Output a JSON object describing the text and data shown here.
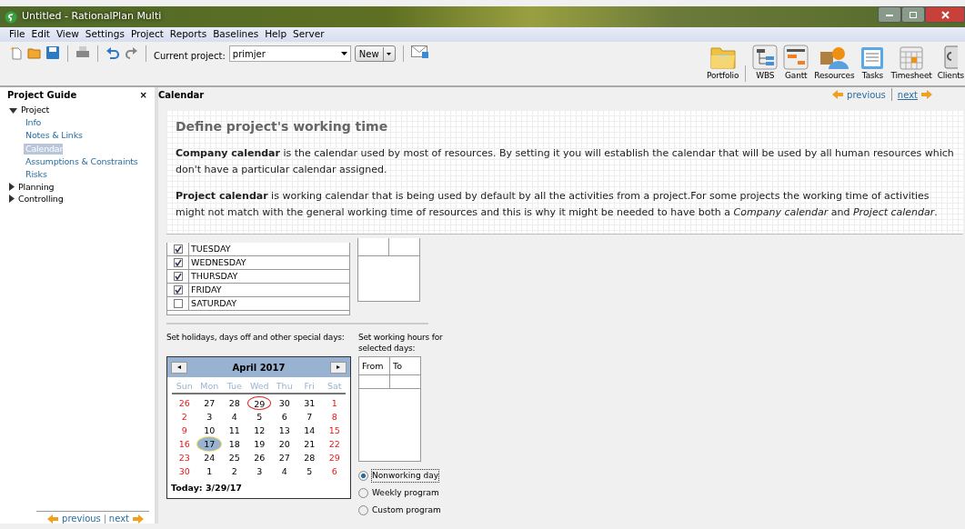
{
  "window": {
    "title": "Untitled - RationalPlan Multi"
  },
  "menu": [
    "File",
    "Edit",
    "View",
    "Settings",
    "Project",
    "Reports",
    "Baselines",
    "Help",
    "Server"
  ],
  "toolbar": {
    "current_project_label": "Current project:",
    "current_project": "primjer",
    "new_button": "New",
    "modules": [
      {
        "label": "Portfolio",
        "kind": "portfolio"
      },
      {
        "label": "WBS",
        "kind": "wbs"
      },
      {
        "label": "Gantt",
        "kind": "gantt"
      },
      {
        "label": "Resources",
        "kind": "resources"
      },
      {
        "label": "Tasks",
        "kind": "tasks"
      },
      {
        "label": "Timesheet",
        "kind": "timesheet"
      },
      {
        "label": "Clients",
        "kind": "clients"
      }
    ]
  },
  "project_guide": {
    "title": "Project Guide",
    "close": "×",
    "tree": [
      {
        "label": "Project",
        "expanded": true,
        "selected": false,
        "children": [
          {
            "label": "Info",
            "selected": false
          },
          {
            "label": "Notes & Links",
            "selected": false
          },
          {
            "label": "Calendar",
            "selected": true
          },
          {
            "label": "Assumptions & Constraints",
            "selected": false
          },
          {
            "label": "Risks",
            "selected": false
          }
        ]
      },
      {
        "label": "Planning",
        "expanded": false,
        "selected": false
      },
      {
        "label": "Controlling",
        "expanded": false,
        "selected": false
      }
    ],
    "previous": "previous",
    "next": "next"
  },
  "content": {
    "title": "Calendar",
    "previous": "previous",
    "next": "next",
    "help": {
      "heading": "Define project's working time",
      "paragraphs": [
        "**Company calendar** is the calendar used by most of resources. By setting it you will establish the calendar that will be used by all human resources which don't have a particular calendar assigned.",
        "**Project calendar** is working calendar that is being used by default by all the activities from a project.For some projects the working time of activities might not match with the general working time of resources and this is why it might be needed to have both a *Company calendar* and *Project calendar*."
      ]
    },
    "weekdays": [
      {
        "label": "TUESDAY",
        "checked": true
      },
      {
        "label": "WEDNESDAY",
        "checked": true
      },
      {
        "label": "THURSDAY",
        "checked": true
      },
      {
        "label": "FRIDAY",
        "checked": true
      },
      {
        "label": "SATURDAY",
        "checked": false
      }
    ],
    "holidays_label": "Set holidays, days off and other special days:",
    "hours_label": "Set working hours for selected days:",
    "calendar": {
      "month": "April 2017",
      "prev": "◂",
      "next": "▸",
      "day_names": [
        "Sun",
        "Mon",
        "Tue",
        "Wed",
        "Thu",
        "Fri",
        "Sat"
      ],
      "weeks": [
        [
          {
            "day": "26",
            "weekend": true,
            "today": false,
            "selected": false
          },
          {
            "day": "27",
            "weekend": false,
            "today": false,
            "selected": false
          },
          {
            "day": "28",
            "weekend": false,
            "today": false,
            "selected": false
          },
          {
            "day": "29",
            "weekend": false,
            "today": true,
            "selected": false
          },
          {
            "day": "30",
            "weekend": false,
            "today": false,
            "selected": false
          },
          {
            "day": "31",
            "weekend": false,
            "today": false,
            "selected": false
          },
          {
            "day": "1",
            "weekend": true,
            "today": false,
            "selected": false
          }
        ],
        [
          {
            "day": "2",
            "weekend": true,
            "today": false,
            "selected": false
          },
          {
            "day": "3",
            "weekend": false,
            "today": false,
            "selected": false
          },
          {
            "day": "4",
            "weekend": false,
            "today": false,
            "selected": false
          },
          {
            "day": "5",
            "weekend": false,
            "today": false,
            "selected": false
          },
          {
            "day": "6",
            "weekend": false,
            "today": false,
            "selected": false
          },
          {
            "day": "7",
            "weekend": false,
            "today": false,
            "selected": false
          },
          {
            "day": "8",
            "weekend": true,
            "today": false,
            "selected": false
          }
        ],
        [
          {
            "day": "9",
            "weekend": true,
            "today": false,
            "selected": false
          },
          {
            "day": "10",
            "weekend": false,
            "today": false,
            "selected": false
          },
          {
            "day": "11",
            "weekend": false,
            "today": false,
            "selected": false
          },
          {
            "day": "12",
            "weekend": false,
            "today": false,
            "selected": false
          },
          {
            "day": "13",
            "weekend": false,
            "today": false,
            "selected": false
          },
          {
            "day": "14",
            "weekend": false,
            "today": false,
            "selected": false
          },
          {
            "day": "15",
            "weekend": true,
            "today": false,
            "selected": false
          }
        ],
        [
          {
            "day": "16",
            "weekend": true,
            "today": false,
            "selected": false
          },
          {
            "day": "17",
            "weekend": false,
            "today": false,
            "selected": true
          },
          {
            "day": "18",
            "weekend": false,
            "today": false,
            "selected": false
          },
          {
            "day": "19",
            "weekend": false,
            "today": false,
            "selected": false
          },
          {
            "day": "20",
            "weekend": false,
            "today": false,
            "selected": false
          },
          {
            "day": "21",
            "weekend": false,
            "today": false,
            "selected": false
          },
          {
            "day": "22",
            "weekend": true,
            "today": false,
            "selected": false
          }
        ],
        [
          {
            "day": "23",
            "weekend": true,
            "today": false,
            "selected": false
          },
          {
            "day": "24",
            "weekend": false,
            "today": false,
            "selected": false
          },
          {
            "day": "25",
            "weekend": false,
            "today": false,
            "selected": false
          },
          {
            "day": "26",
            "weekend": false,
            "today": false,
            "selected": false
          },
          {
            "day": "27",
            "weekend": false,
            "today": false,
            "selected": false
          },
          {
            "day": "28",
            "weekend": false,
            "today": false,
            "selected": false
          },
          {
            "day": "29",
            "weekend": true,
            "today": false,
            "selected": false
          }
        ],
        [
          {
            "day": "30",
            "weekend": true,
            "today": false,
            "selected": false
          },
          {
            "day": "1",
            "weekend": false,
            "today": false,
            "selected": false
          },
          {
            "day": "2",
            "weekend": false,
            "today": false,
            "selected": false
          },
          {
            "day": "3",
            "weekend": false,
            "today": false,
            "selected": false
          },
          {
            "day": "4",
            "weekend": false,
            "today": false,
            "selected": false
          },
          {
            "day": "5",
            "weekend": false,
            "today": false,
            "selected": false
          },
          {
            "day": "6",
            "weekend": true,
            "today": false,
            "selected": false
          }
        ]
      ],
      "today_label": "Today: 3/29/17"
    },
    "hours_table": {
      "columns": [
        "From",
        "To"
      ]
    },
    "day_type": [
      {
        "label": "Nonworking day",
        "selected": true
      },
      {
        "label": "Weekly program",
        "selected": false
      },
      {
        "label": "Custom program",
        "selected": false
      }
    ]
  }
}
